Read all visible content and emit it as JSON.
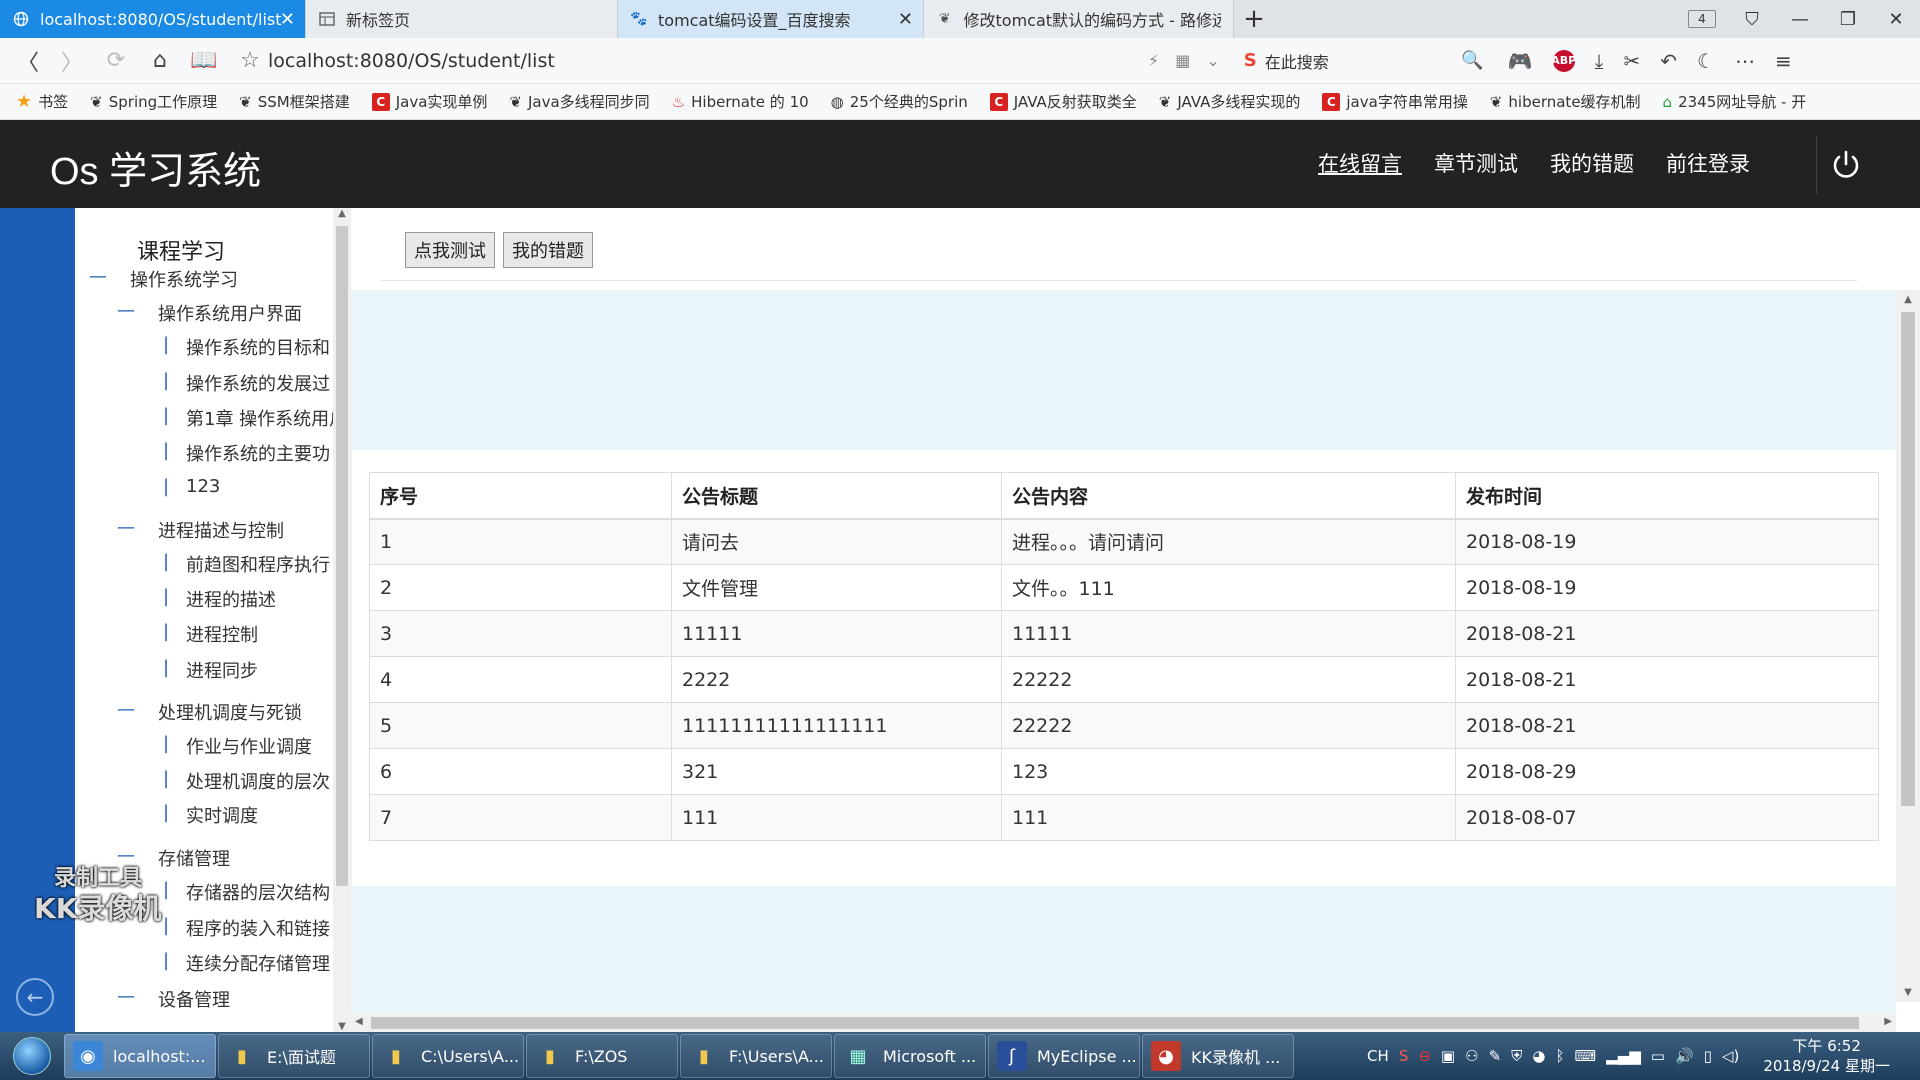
{
  "browser": {
    "tabs": [
      {
        "title": "localhost:8080/OS/student/list",
        "icon": "globe-icon",
        "active": true
      },
      {
        "title": "新标签页",
        "icon": "grid-icon",
        "active": false
      },
      {
        "title": "tomcat编码设置_百度搜索",
        "icon": "paw-icon",
        "active": false
      },
      {
        "title": "修改tomcat默认的编码方式 - 路修远",
        "icon": "leaf-icon",
        "active": false
      }
    ],
    "tab_count": "4",
    "address": "localhost:8080/OS/student/list",
    "search_placeholder": "在此搜索",
    "abp_label": "ABP",
    "bookmarks": [
      {
        "label": "书签",
        "icon": "star-icon"
      },
      {
        "label": "Spring工作原理",
        "icon": "leaf-icon"
      },
      {
        "label": "SSM框架搭建",
        "icon": "leaf-icon"
      },
      {
        "label": "Java实现单例",
        "icon": "c-icon"
      },
      {
        "label": "Java多线程同步同",
        "icon": "leaf-icon"
      },
      {
        "label": "Hibernate 的 10",
        "icon": "java-icon"
      },
      {
        "label": "25个经典的Sprin",
        "icon": "globe-icon"
      },
      {
        "label": "JAVA反射获取类全",
        "icon": "c-icon"
      },
      {
        "label": "JAVA多线程实现的",
        "icon": "leaf-icon"
      },
      {
        "label": "java字符串常用操",
        "icon": "c-icon"
      },
      {
        "label": "hibernate缓存机制",
        "icon": "leaf-icon"
      },
      {
        "label": "2345网址导航 - 开",
        "icon": "house-icon"
      }
    ]
  },
  "header": {
    "title": "Os 学习系统",
    "nav": [
      "在线留言",
      "章节测试",
      "我的错题",
      "前往登录"
    ]
  },
  "sidebar": {
    "title": "课程学习",
    "tree": [
      {
        "label": "操作系统学习",
        "level": 0,
        "marker": "—"
      },
      {
        "label": "操作系统用户界面",
        "level": 1,
        "marker": "—"
      },
      {
        "label": "操作系统的目标和",
        "level": 2,
        "marker": "|"
      },
      {
        "label": "操作系统的发展过",
        "level": 2,
        "marker": "|"
      },
      {
        "label": "第1章 操作系统用户",
        "level": 2,
        "marker": "|"
      },
      {
        "label": "操作系统的主要功",
        "level": 2,
        "marker": "|"
      },
      {
        "label": "123",
        "level": 2,
        "marker": "|"
      },
      {
        "label": "进程描述与控制",
        "level": 1,
        "marker": "—"
      },
      {
        "label": "前趋图和程序执行",
        "level": 2,
        "marker": "|"
      },
      {
        "label": "进程的描述",
        "level": 2,
        "marker": "|"
      },
      {
        "label": "进程控制",
        "level": 2,
        "marker": "|"
      },
      {
        "label": "进程同步",
        "level": 2,
        "marker": "|"
      },
      {
        "label": "处理机调度与死锁",
        "level": 1,
        "marker": "—"
      },
      {
        "label": "作业与作业调度",
        "level": 2,
        "marker": "|"
      },
      {
        "label": "处理机调度的层次",
        "level": 2,
        "marker": "|"
      },
      {
        "label": "实时调度",
        "level": 2,
        "marker": "|"
      },
      {
        "label": "存储管理",
        "level": 1,
        "marker": "—"
      },
      {
        "label": "存储器的层次结构",
        "level": 2,
        "marker": "|"
      },
      {
        "label": "程序的装入和链接",
        "level": 2,
        "marker": "|"
      },
      {
        "label": "连续分配存储管理",
        "level": 2,
        "marker": "|"
      },
      {
        "label": "设备管理",
        "level": 1,
        "marker": "—"
      }
    ]
  },
  "watermark": {
    "line1": "录制工具",
    "line2": "KK录像机"
  },
  "main": {
    "buttons": [
      "点我测试",
      "我的错题"
    ],
    "table": {
      "headers": [
        "序号",
        "公告标题",
        "公告内容",
        "发布时间"
      ],
      "rows": [
        [
          "1",
          "请问去",
          "进程。。。请问请问",
          "2018-08-19"
        ],
        [
          "2",
          "文件管理",
          "文件。。111",
          "2018-08-19"
        ],
        [
          "3",
          "11111",
          "11111",
          "2018-08-21"
        ],
        [
          "4",
          "2222",
          "22222",
          "2018-08-21"
        ],
        [
          "5",
          "11111111111111111",
          "22222",
          "2018-08-21"
        ],
        [
          "6",
          "321",
          "123",
          "2018-08-29"
        ],
        [
          "7",
          "111",
          "111",
          "2018-08-07"
        ]
      ]
    }
  },
  "taskbar": {
    "items": [
      {
        "label": "localhost:...",
        "icon": "browser-icon",
        "active": true
      },
      {
        "label": "E:\\面试题",
        "icon": "folder-icon",
        "active": false
      },
      {
        "label": "C:\\Users\\A...",
        "icon": "folder-icon",
        "active": false
      },
      {
        "label": "F:\\ZOS",
        "icon": "folder-icon",
        "active": false
      },
      {
        "label": "F:\\Users\\A...",
        "icon": "folder-icon",
        "active": false
      },
      {
        "label": "Microsoft ...",
        "icon": "app-icon",
        "active": false
      },
      {
        "label": "MyEclipse ...",
        "icon": "eclipse-icon",
        "active": false
      },
      {
        "label": "KK录像机 ...",
        "icon": "recorder-icon",
        "active": false
      }
    ],
    "ime": "CH",
    "time": "下午 6:52",
    "date": "2018/9/24 星期一"
  },
  "colors": {
    "header_bg": "#222222",
    "left_strip": "#1c5eb5",
    "content_bg": "#e9f5f8",
    "active_tab": "#1a8ae5"
  }
}
